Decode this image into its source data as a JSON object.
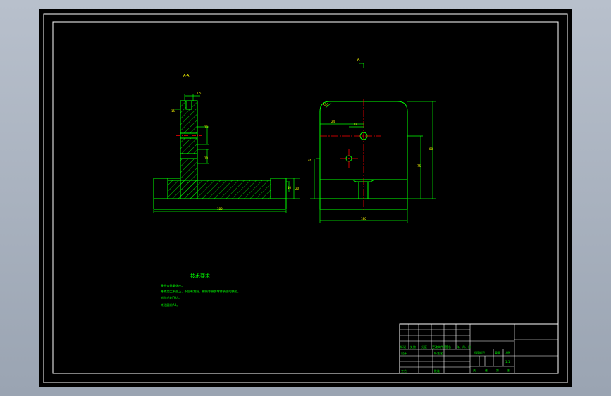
{
  "colors": {
    "background": "#000000",
    "frame": "#ffffff",
    "outline": "#00ff00",
    "dimension": "#ffff00",
    "center_line": "#ff0000",
    "hatch": "#00ff00",
    "viewport_bg": "#a9b1bd"
  },
  "drawing": {
    "section_label": "A-A",
    "top_view_label": "A",
    "side_view": {
      "dim_bottom": "180",
      "dim_right_a": "20",
      "dim_right_b": "10",
      "dim_hole_a": "10",
      "dim_hole_b": "10",
      "dim_top_slot": "1.5",
      "dim_left_slot": "15"
    },
    "front_view": {
      "dim_total_height": "80",
      "dim_inner_height": "75",
      "dim_left_height": "46",
      "dim_width": "180",
      "dim_radius": "R10",
      "dim_hole_offset_a": "24",
      "dim_hole_offset_b": "18"
    },
    "tech_notes": {
      "title": "技术要求",
      "lines": [
        "零件去除氧化皮。",
        "零件加工表面上，不应有划痕、擦伤等损伤零件表面的缺陷。",
        "去除毛刺飞边。",
        "未注圆角R5。"
      ]
    }
  },
  "title_block": {
    "row_labels": [
      "标记",
      "处数",
      "分区",
      "更改文件号",
      "签名",
      "年、月、日"
    ],
    "design": "设计",
    "standardize": "标准化",
    "process": "工艺",
    "approve": "批准",
    "stage_mark": "阶段标记",
    "weight": "重量",
    "ratio": "比例",
    "ratio_value": "1:1",
    "sheets": [
      "共",
      "张",
      "第",
      "张"
    ]
  }
}
